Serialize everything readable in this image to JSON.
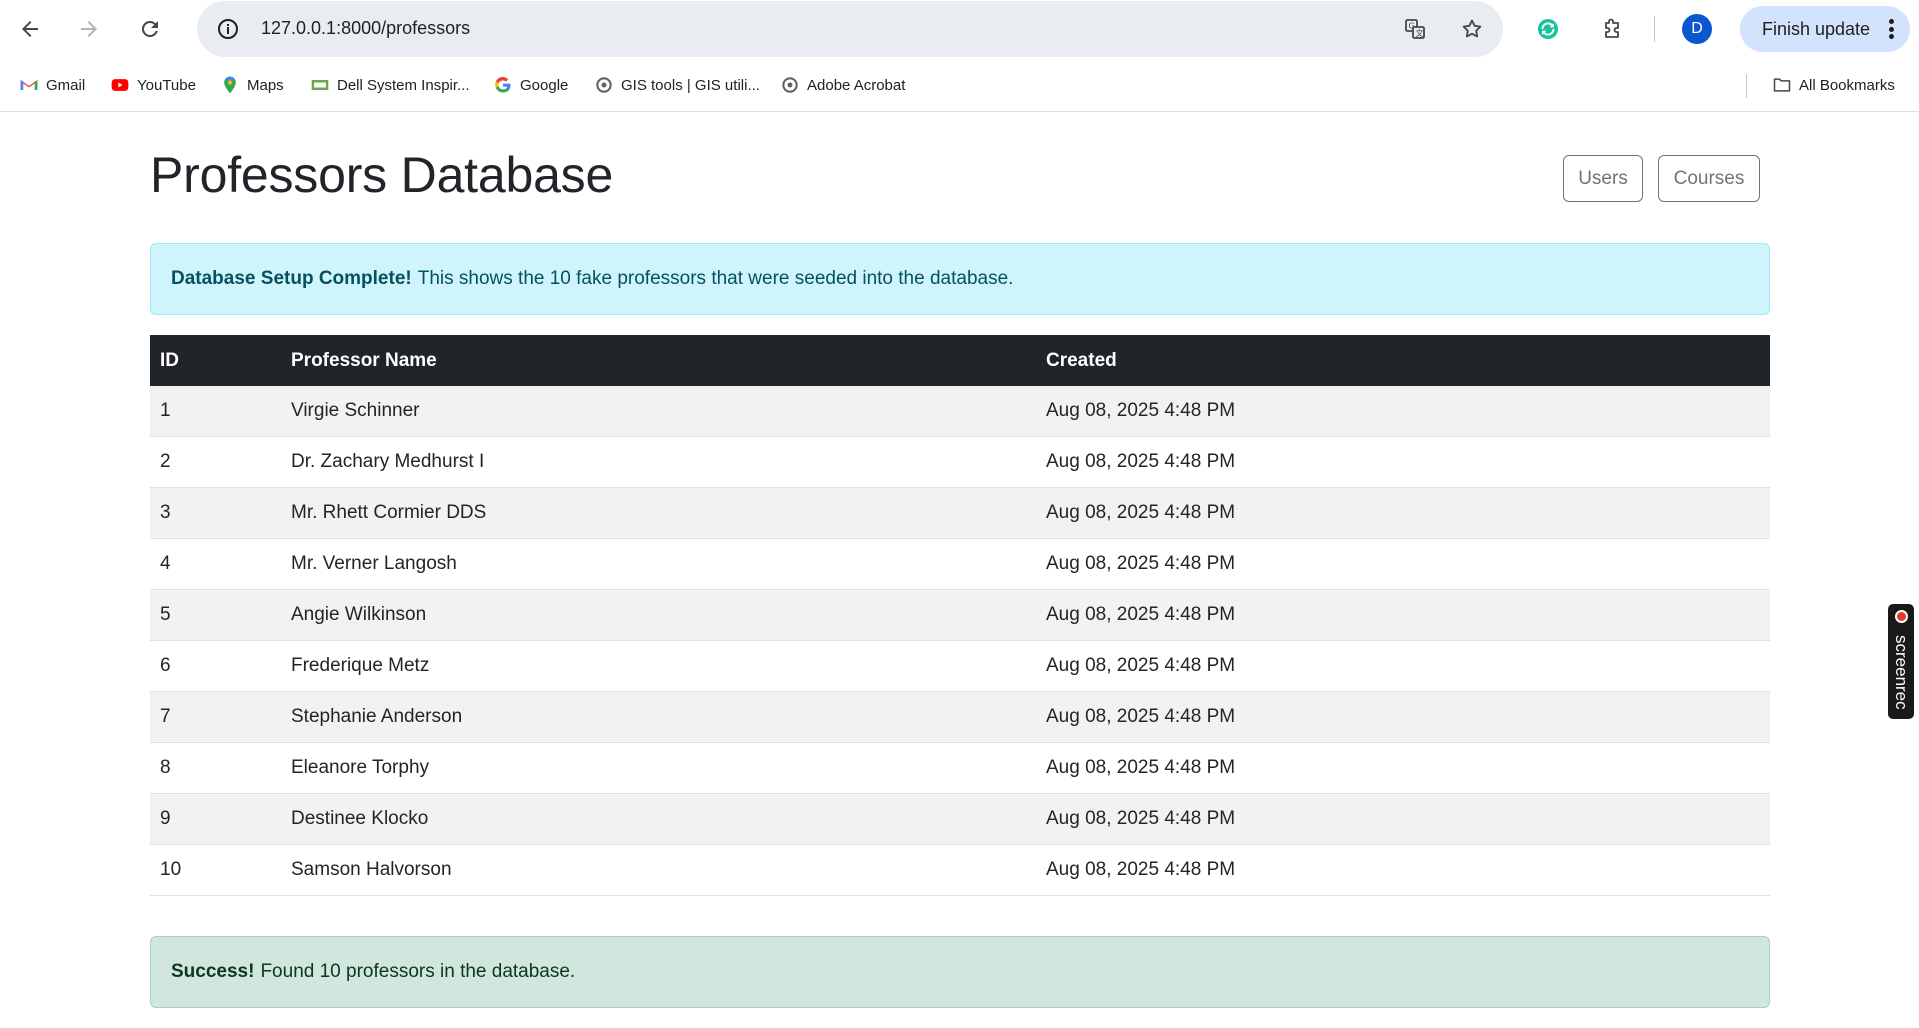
{
  "browser": {
    "url": "127.0.0.1:8000/professors",
    "avatar_letter": "D",
    "finish_update_label": "Finish update",
    "bookmarks": [
      {
        "label": "Gmail",
        "icon": "gmail-icon"
      },
      {
        "label": "YouTube",
        "icon": "youtube-icon"
      },
      {
        "label": "Maps",
        "icon": "maps-icon"
      },
      {
        "label": "Dell System Inspir...",
        "icon": "dell-icon"
      },
      {
        "label": "Google",
        "icon": "google-icon"
      },
      {
        "label": "GIS tools | GIS utili...",
        "icon": "gis-icon"
      },
      {
        "label": "Adobe Acrobat",
        "icon": "acrobat-icon"
      }
    ],
    "all_bookmarks_label": "All Bookmarks"
  },
  "page": {
    "title": "Professors Database",
    "nav_buttons": {
      "users": "Users",
      "courses": "Courses"
    },
    "info_alert": {
      "strong": "Database Setup Complete!",
      "text": "This shows the 10 fake professors that were seeded into the database."
    },
    "table": {
      "headers": {
        "id": "ID",
        "name": "Professor Name",
        "created": "Created"
      },
      "rows": [
        {
          "id": "1",
          "name": "Virgie Schinner",
          "created": "Aug 08, 2025 4:48 PM"
        },
        {
          "id": "2",
          "name": "Dr. Zachary Medhurst I",
          "created": "Aug 08, 2025 4:48 PM"
        },
        {
          "id": "3",
          "name": "Mr. Rhett Cormier DDS",
          "created": "Aug 08, 2025 4:48 PM"
        },
        {
          "id": "4",
          "name": "Mr. Verner Langosh",
          "created": "Aug 08, 2025 4:48 PM"
        },
        {
          "id": "5",
          "name": "Angie Wilkinson",
          "created": "Aug 08, 2025 4:48 PM"
        },
        {
          "id": "6",
          "name": "Frederique Metz",
          "created": "Aug 08, 2025 4:48 PM"
        },
        {
          "id": "7",
          "name": "Stephanie Anderson",
          "created": "Aug 08, 2025 4:48 PM"
        },
        {
          "id": "8",
          "name": "Eleanore Torphy",
          "created": "Aug 08, 2025 4:48 PM"
        },
        {
          "id": "9",
          "name": "Destinee Klocko",
          "created": "Aug 08, 2025 4:48 PM"
        },
        {
          "id": "10",
          "name": "Samson Halvorson",
          "created": "Aug 08, 2025 4:48 PM"
        }
      ]
    },
    "success_alert": {
      "strong": "Success!",
      "text": "Found 10 professors in the database."
    }
  },
  "overlay": {
    "screenrec_label": "screenrec"
  },
  "colors": {
    "table_header_bg": "#212529",
    "info_bg": "#cff4fc",
    "success_bg": "#d1e7dd",
    "avatar_bg": "#0b57d0",
    "finish_update_bg": "#d3e3fd"
  }
}
